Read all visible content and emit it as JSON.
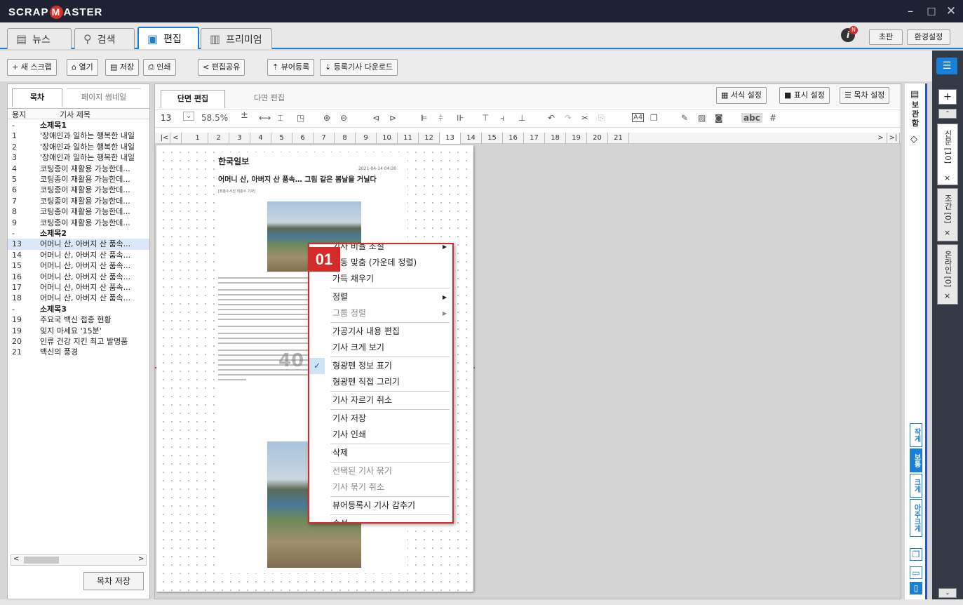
{
  "app": {
    "logo_left": "SCRAP",
    "logo_m": "M",
    "logo_right": "ASTER"
  },
  "window": {
    "minimize": "–",
    "maximize": "□",
    "close": "✕"
  },
  "main_tabs": [
    {
      "label": "뉴스",
      "icon": "newspaper-icon"
    },
    {
      "label": "검색",
      "icon": "search-icon"
    },
    {
      "label": "편집",
      "icon": "clipboard-icon"
    },
    {
      "label": "프리미엄",
      "icon": "chart-icon"
    }
  ],
  "top_right": {
    "notice_badge": "N",
    "edition": "초판",
    "settings": "환경설정"
  },
  "toolbar": {
    "new": "+ 새 스크랩",
    "open": "열기",
    "save": "저장",
    "print": "인쇄",
    "share": "편집공유",
    "viewer_register": "뷰어등록",
    "download": "등록기사 다운로드"
  },
  "left_panel": {
    "tab_toc": "목차",
    "tab_thumb": "페이지 썸네일",
    "col_page": "용지",
    "col_title": "기사 제목",
    "save_btn": "목차 저장",
    "rows": [
      {
        "n": "-",
        "t": "소제목1",
        "sec": true
      },
      {
        "n": "1",
        "t": "'장애인과 일하는 행복한 내일"
      },
      {
        "n": "2",
        "t": "'장애인과 일하는 행복한 내일"
      },
      {
        "n": "3",
        "t": "'장애인과 일하는 행복한 내일"
      },
      {
        "n": "4",
        "t": "코팅종이 재활용 가능한데..."
      },
      {
        "n": "5",
        "t": "코팅종이 재활용 가능한데..."
      },
      {
        "n": "6",
        "t": "코팅종이 재활용 가능한데..."
      },
      {
        "n": "7",
        "t": "코팅종이 재활용 가능한데..."
      },
      {
        "n": "8",
        "t": "코팅종이 재활용 가능한데..."
      },
      {
        "n": "9",
        "t": "코팅종이 재활용 가능한데..."
      },
      {
        "n": "-",
        "t": "소제목2",
        "sec": true
      },
      {
        "n": "13",
        "t": "어머니 산, 아버지 산 품속...",
        "sel": true
      },
      {
        "n": "14",
        "t": "어머니 산, 아버지 산 품속..."
      },
      {
        "n": "15",
        "t": "어머니 산, 아버지 산 품속..."
      },
      {
        "n": "16",
        "t": "어머니 산, 아버지 산 품속..."
      },
      {
        "n": "17",
        "t": "어머니 산, 아버지 산 품속..."
      },
      {
        "n": "18",
        "t": "어머니 산, 아버지 산 품속..."
      },
      {
        "n": "-",
        "t": "소제목3",
        "sec": true
      },
      {
        "n": "19",
        "t": "주요국 백신 접종 현황"
      },
      {
        "n": "19",
        "t": "잊지 마세요 '15분'"
      },
      {
        "n": "20",
        "t": "인류 건강 지킨 최고 발명품"
      },
      {
        "n": "21",
        "t": "백신의 풍경"
      }
    ]
  },
  "editor": {
    "tab_single": "단면 편집",
    "tab_multi": "다면 편집",
    "format_btn": "서식 설정",
    "display_btn": "표시 설정",
    "toc_btn": "목차 설정",
    "page_num": "13",
    "zoom": "58.5%",
    "abc": "abc"
  },
  "pages": [
    "1",
    "2",
    "3",
    "4",
    "5",
    "6",
    "7",
    "8",
    "9",
    "10",
    "11",
    "12",
    "13",
    "14",
    "15",
    "16",
    "17",
    "18",
    "19",
    "20",
    "21"
  ],
  "article": {
    "paper": "한국일보",
    "date": "2021-04-14 04:30",
    "headline": "어머니 산, 아버지 산 품속… 그림 같은 봄날을 거닐다",
    "byline": "[최흥수사진 최흥수 기자]",
    "watermark": "40"
  },
  "context_menu": {
    "badge": "01",
    "items": [
      {
        "label": "기사 비율 조절",
        "arrow": true
      },
      {
        "label": "자동 맞춤 (가운데 정렬)"
      },
      {
        "label": "가득 채우기"
      },
      {
        "label": "정렬",
        "arrow": true,
        "sep_before": true
      },
      {
        "label": "그룹 정렬",
        "arrow": true,
        "dis": true
      },
      {
        "label": "가공기사 내용 편집",
        "sep_before": true
      },
      {
        "label": "기사 크게 보기"
      },
      {
        "label": "형광펜 정보 표기",
        "sep_before": true,
        "checked": true
      },
      {
        "label": "형광펜 직접 그리기"
      },
      {
        "label": "기사 자르기 취소",
        "sep_before": true
      },
      {
        "label": "기사 저장",
        "sep_before": true
      },
      {
        "label": "기사 인쇄"
      },
      {
        "label": "삭제",
        "sep_before": true
      },
      {
        "label": "선택된 기사 묶기",
        "dis": true,
        "sep_before": true
      },
      {
        "label": "기사 묶기 취소",
        "dis": true
      },
      {
        "label": "뷰어등록시 기사 감추기",
        "sep_before": true
      },
      {
        "label": "속성",
        "arrow": true,
        "sep_before": true
      }
    ]
  },
  "side_panel": {
    "storage": "보관함",
    "sizes": [
      "작게",
      "보통",
      "크게",
      "아주크게"
    ]
  },
  "right_rail": {
    "tabs": [
      "신문 [10]",
      "조간 [0]",
      "온라인 [0]"
    ],
    "close": "×",
    "add": "+"
  }
}
